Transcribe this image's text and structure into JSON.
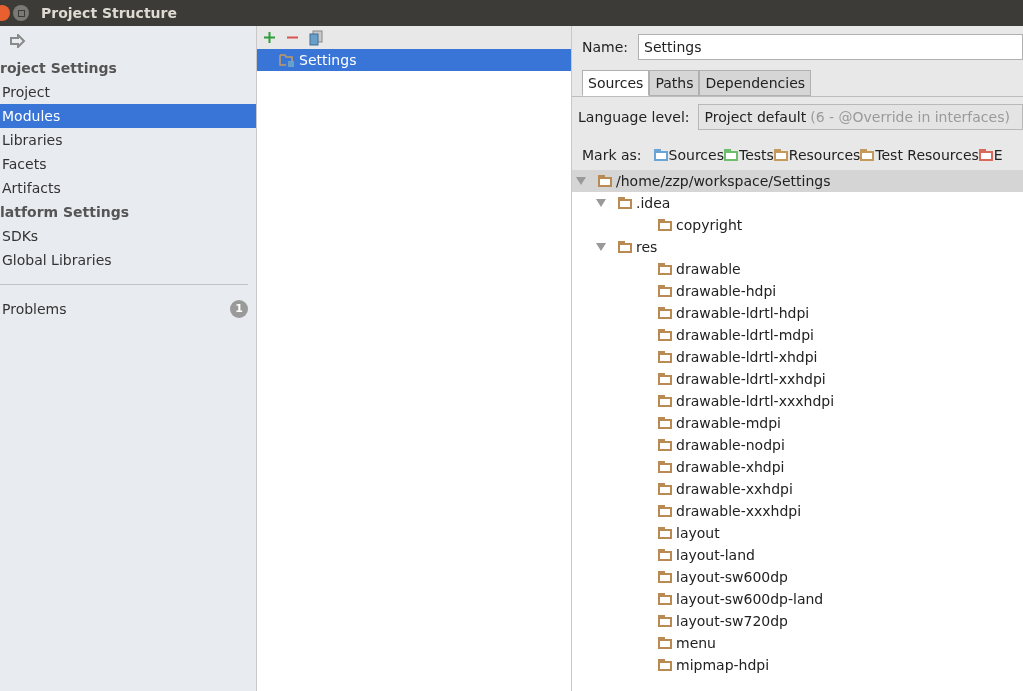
{
  "window": {
    "title": "Project Structure"
  },
  "sidebar": {
    "items": [
      {
        "kind": "header",
        "label": "roject Settings"
      },
      {
        "kind": "item",
        "label": "Project",
        "selected": false
      },
      {
        "kind": "item",
        "label": "Modules",
        "selected": true
      },
      {
        "kind": "item",
        "label": "Libraries",
        "selected": false
      },
      {
        "kind": "item",
        "label": "Facets",
        "selected": false
      },
      {
        "kind": "item",
        "label": "Artifacts",
        "selected": false
      },
      {
        "kind": "header",
        "label": "latform Settings"
      },
      {
        "kind": "item",
        "label": "SDKs",
        "selected": false
      },
      {
        "kind": "item",
        "label": "Global Libraries",
        "selected": false
      },
      {
        "kind": "separator"
      },
      {
        "kind": "item",
        "label": "Problems",
        "selected": false,
        "badge": "1"
      }
    ]
  },
  "modules": {
    "items": [
      {
        "label": "Settings",
        "selected": true
      }
    ]
  },
  "name_field": {
    "label": "Name:",
    "value": "Settings"
  },
  "tabs": [
    {
      "label": "Sources",
      "selected": true
    },
    {
      "label": "Paths",
      "selected": false
    },
    {
      "label": "Dependencies",
      "selected": false
    }
  ],
  "language_level": {
    "label": "Language level:",
    "value": "Project default",
    "hint": "(6 - @Override in interfaces)"
  },
  "mark_as": {
    "label": "Mark as:",
    "buttons": [
      {
        "label": "Sources",
        "color": "#6aa5d6"
      },
      {
        "label": "Tests",
        "color": "#6dbd6d"
      },
      {
        "label": "Resources",
        "color": "#c49a5c"
      },
      {
        "label": "Test Resources",
        "color": "#c49a5c"
      },
      {
        "label": "E",
        "color": "#d9695a"
      }
    ]
  },
  "tree": {
    "label": "/home/zzp/workspace/Settings",
    "selected": true,
    "expanded": true,
    "children": [
      {
        "label": ".idea",
        "selected": false,
        "expanded": true,
        "children": [
          {
            "label": "copyright",
            "selected": false
          }
        ]
      },
      {
        "label": "res",
        "selected": false,
        "expanded": true,
        "children": [
          {
            "label": "drawable",
            "selected": false
          },
          {
            "label": "drawable-hdpi",
            "selected": false
          },
          {
            "label": "drawable-ldrtl-hdpi",
            "selected": false
          },
          {
            "label": "drawable-ldrtl-mdpi",
            "selected": false
          },
          {
            "label": "drawable-ldrtl-xhdpi",
            "selected": false
          },
          {
            "label": "drawable-ldrtl-xxhdpi",
            "selected": false
          },
          {
            "label": "drawable-ldrtl-xxxhdpi",
            "selected": false
          },
          {
            "label": "drawable-mdpi",
            "selected": false
          },
          {
            "label": "drawable-nodpi",
            "selected": false
          },
          {
            "label": "drawable-xhdpi",
            "selected": false
          },
          {
            "label": "drawable-xxhdpi",
            "selected": false
          },
          {
            "label": "drawable-xxxhdpi",
            "selected": false
          },
          {
            "label": "layout",
            "selected": false
          },
          {
            "label": "layout-land",
            "selected": false
          },
          {
            "label": "layout-sw600dp",
            "selected": false
          },
          {
            "label": "layout-sw600dp-land",
            "selected": false
          },
          {
            "label": "layout-sw720dp",
            "selected": false
          },
          {
            "label": "menu",
            "selected": false
          },
          {
            "label": "mipmap-hdpi",
            "selected": false
          }
        ]
      }
    ]
  }
}
